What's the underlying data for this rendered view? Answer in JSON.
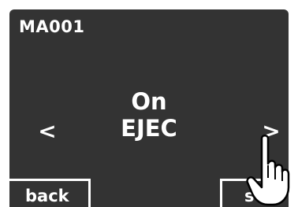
{
  "screen": {
    "device_id": "MA001",
    "status_line1": "On",
    "status_line2": "EJEC",
    "prev_label": "<",
    "next_label": ">",
    "back_label": "back",
    "stop_label": "stop"
  },
  "colors": {
    "background": "#333333",
    "text": "#ffffff"
  },
  "icons": {
    "pointer": "pointing-hand-icon"
  }
}
